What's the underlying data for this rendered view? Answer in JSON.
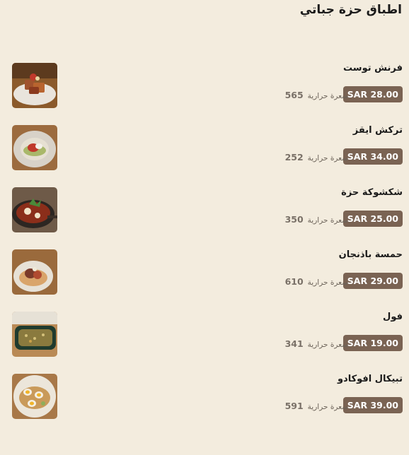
{
  "page": {
    "title": "اطباق حزة جباتي"
  },
  "items": [
    {
      "name": "فرنش توست",
      "price": "SAR 28.00",
      "calories": "565",
      "cal_unit": "سعرة حرارية",
      "image_icon": "french-toast-photo"
    },
    {
      "name": "تركش ايقز",
      "price": "SAR 34.00",
      "calories": "252",
      "cal_unit": "سعرة حرارية",
      "image_icon": "turkish-eggs-photo"
    },
    {
      "name": "شكشوكة حزة",
      "price": "SAR 25.00",
      "calories": "350",
      "cal_unit": "سعرة حرارية",
      "image_icon": "shakshuka-photo"
    },
    {
      "name": "حمسة باذنجان",
      "price": "SAR 29.00",
      "calories": "610",
      "cal_unit": "سعرة حرارية",
      "image_icon": "eggplant-dish-photo"
    },
    {
      "name": "فول",
      "price": "SAR 19.00",
      "calories": "341",
      "cal_unit": "سعرة حرارية",
      "image_icon": "foul-photo"
    },
    {
      "name": "تبيكال افوكادو",
      "price": "SAR 39.00",
      "calories": "591",
      "cal_unit": "سعرة حرارية",
      "image_icon": "avocado-toast-photo"
    }
  ]
}
